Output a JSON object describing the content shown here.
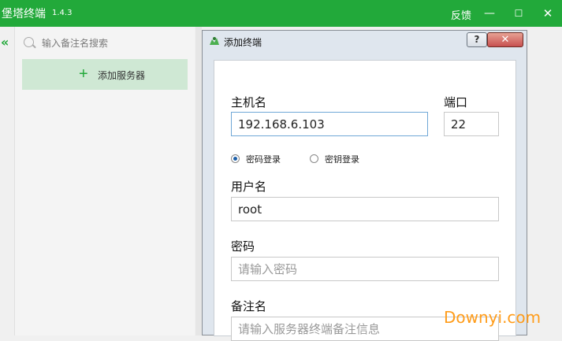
{
  "app": {
    "title": "堡塔终端",
    "version": "1.4.3",
    "feedback": "反馈"
  },
  "window_controls": {
    "minimize": "—",
    "maximize": "☐",
    "close": "✕"
  },
  "sidebar": {
    "collapse_icon": "«",
    "search_placeholder": "输入备注名搜索",
    "add_server_label": "添加服务器"
  },
  "dialog": {
    "title": "添加终端",
    "help": "?",
    "close": "✕",
    "host_label": "主机名",
    "host_value": "192.168.6.103",
    "port_label": "端口",
    "port_value": "22",
    "auth_password_label": "密码登录",
    "auth_key_label": "密钥登录",
    "auth_selected": "密码登录",
    "username_label": "用户名",
    "username_value": "root",
    "password_label": "密码",
    "password_placeholder": "请输入密码",
    "remark_label": "备注名",
    "remark_placeholder": "请输入服务器终端备注信息"
  },
  "watermark": "Downyi.com",
  "colors": {
    "brand_green": "#22a93a",
    "add_button_bg": "#cfe8d4",
    "watermark": "#ff9c1a"
  }
}
